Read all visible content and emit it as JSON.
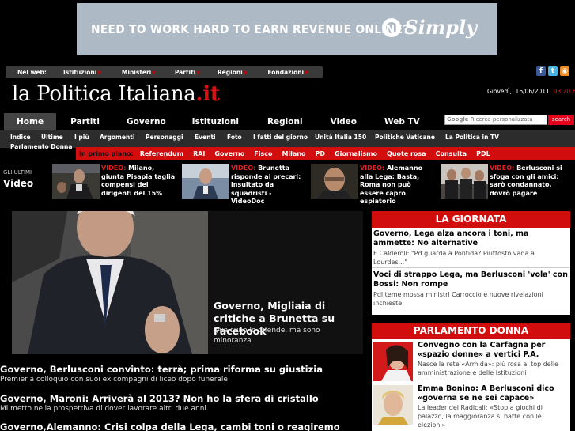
{
  "banner": {
    "text": "NEED TO WORK HARD TO EARN REVENUE ONLINE?",
    "brand": "Simply"
  },
  "webnav": {
    "label": "Nel web:",
    "items": [
      "Istituzioni",
      "Ministeri",
      "Partiti",
      "Regioni",
      "Fondazioni"
    ]
  },
  "social": [
    "facebook-icon",
    "twitter-icon",
    "rss-icon"
  ],
  "site": {
    "name": "la Politica Italiana",
    "tld": ".it"
  },
  "date": {
    "day": "Giovedì,",
    "date": "16/06/2011",
    "time": "08.20.6"
  },
  "mainnav": [
    "Home",
    "Partiti",
    "Governo",
    "Istituzioni",
    "Regioni",
    "Video",
    "Web TV"
  ],
  "search": {
    "brand": "Google",
    "placeholder": "Ricerca personalizzata",
    "button": "search"
  },
  "subnav": [
    "Indice",
    "Ultime",
    "I più",
    "Argomenti",
    "Personaggi",
    "Eventi",
    "Foto",
    "I fatti del giorno",
    "Unità Italia 150",
    "Politiche Vaticane",
    "La Politica in TV",
    "Parlamento Donna"
  ],
  "primo": {
    "label": "In primo piano:",
    "items": [
      "Referendum",
      "RAI",
      "Governo",
      "Fisco",
      "Milano",
      "PD",
      "Giornalismo",
      "Quote rosa",
      "Consulta",
      "PDL"
    ]
  },
  "video": {
    "label_small": "GLI ULTIMI",
    "label_big": "Video",
    "tag": "VIDEO:",
    "items": [
      {
        "text": "Milano, giunta Pisapia taglia compensi dei dirigenti del 15%"
      },
      {
        "text": "Brunetta risponde ai precari: insultato da squadristi - VideoDoc"
      },
      {
        "text": "Alemanno alla Lega: Basta, Roma non può essere capro espiatorio"
      },
      {
        "text": "Berlusconi si sfoga con gli amici: sarò condannato, dovrò pagare"
      }
    ]
  },
  "hero": {
    "title": "Governo, Migliaia di critiche a Brunetta su Facebook",
    "subtitle": "Qualcuno lo difende, ma sono minoranza"
  },
  "headlines": [
    {
      "title": "Governo, Berlusconi convinto: terrà; prima riforma su giustizia",
      "summary": "Premier a colloquio con suoi ex compagni di liceo dopo funerale"
    },
    {
      "title": "Governo, Maroni: Arriverà al 2013? Non ho la sfera di cristallo",
      "summary": "Mi metto nella prospettiva di dover lavorare altri due anni"
    },
    {
      "title": "Governo,Alemanno: Crisi colpa della Lega, cambi toni o reagiremo",
      "summary": ""
    }
  ],
  "giornata": {
    "header": "LA GIORNATA",
    "items": [
      {
        "title": "Governo, Lega alza ancora i toni, ma ammette: No alternative",
        "summary": "E Calderoli: \"Pd guarda a Pontida? Piuttosto vada a Lourdes...\""
      },
      {
        "title": "Voci di strappo Lega, ma Berlusconi 'vola' con Bossi: Non rompe",
        "summary": "Pdl teme mossa ministri Carroccio e nuove rivelazioni inchieste"
      }
    ]
  },
  "parlamento": {
    "header": "PARLAMENTO DONNA",
    "items": [
      {
        "title": "Convegno con la Carfagna per «spazio donne» a vertici P.A.",
        "summary": "Nasce la rete «Armida»: più rosa al top delle amministrazione e delle Istituzioni"
      },
      {
        "title": "Emma Bonino: A Berlusconi dico «governa se ne sei capace»",
        "summary": "La leader dei Radicali: «Stop a giochi di palazzo, la maggioranza si batte con le elezioni»"
      }
    ]
  },
  "colors": {
    "accent": "#d10d0d",
    "background": "#000000"
  }
}
